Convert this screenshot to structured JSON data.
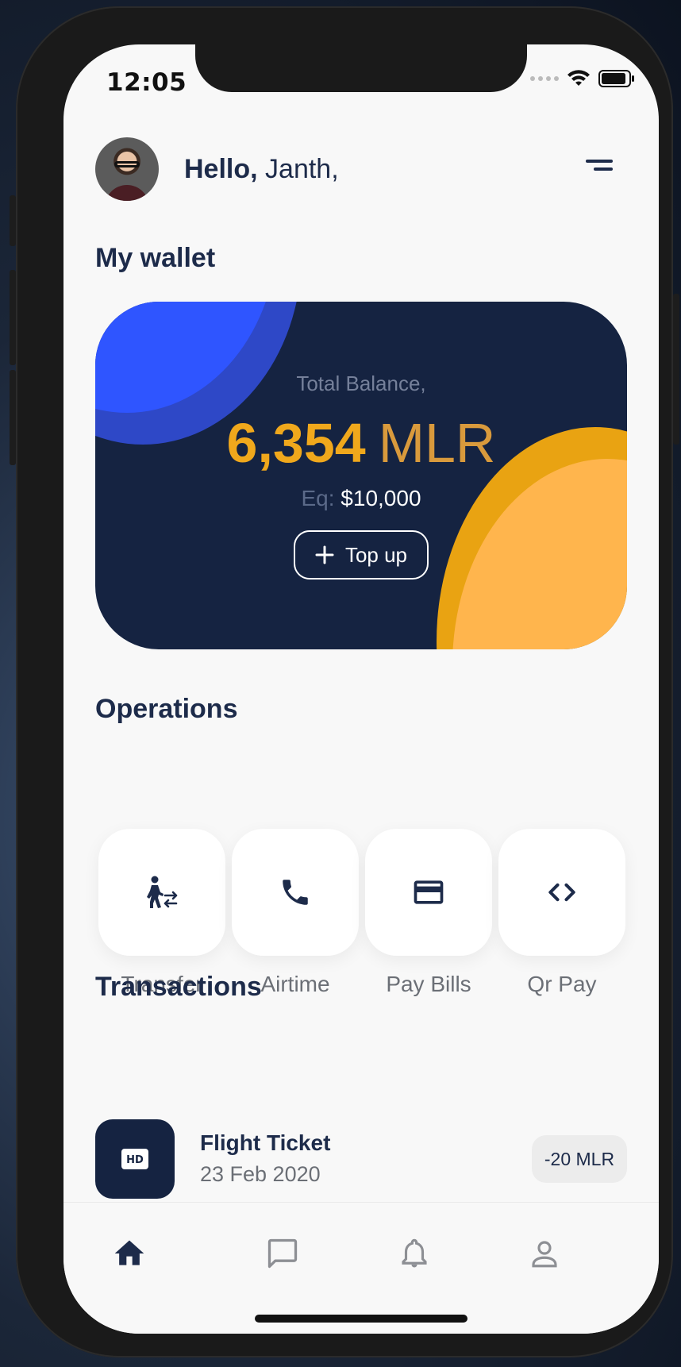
{
  "status_bar": {
    "time": "12:05"
  },
  "header": {
    "greeting_bold": "Hello,",
    "user_name": "Janth,"
  },
  "wallet": {
    "title": "My wallet",
    "balance_label": "Total Balance,",
    "balance_amount": "6,354",
    "balance_currency": "MLR",
    "equivalent_label": "Eq:",
    "equivalent_value": "$10,000",
    "topup_label": "Top up"
  },
  "operations": {
    "title": "Operations",
    "items": [
      {
        "label": "Transfer",
        "icon": "transfer-icon"
      },
      {
        "label": "Airtime",
        "icon": "phone-icon"
      },
      {
        "label": "Pay Bills",
        "icon": "credit-card-icon"
      },
      {
        "label": "Qr Pay",
        "icon": "code-icon"
      }
    ]
  },
  "transactions": {
    "title": "Transactions",
    "items": [
      {
        "name": "Flight Ticket",
        "date": "23 Feb 2020",
        "amount": "-20 MLR",
        "icon": "hd-icon"
      }
    ]
  },
  "tabbar": {
    "tabs": [
      {
        "icon": "home-icon",
        "active": true
      },
      {
        "icon": "chat-icon",
        "active": false
      },
      {
        "icon": "bell-icon",
        "active": false
      },
      {
        "icon": "person-icon",
        "active": false
      }
    ]
  },
  "colors": {
    "primary_navy": "#152341",
    "accent_orange": "#f0a81c",
    "accent_blue": "#2f55ff",
    "text_dark": "#1d2b4a",
    "text_muted": "#6b6f76"
  }
}
